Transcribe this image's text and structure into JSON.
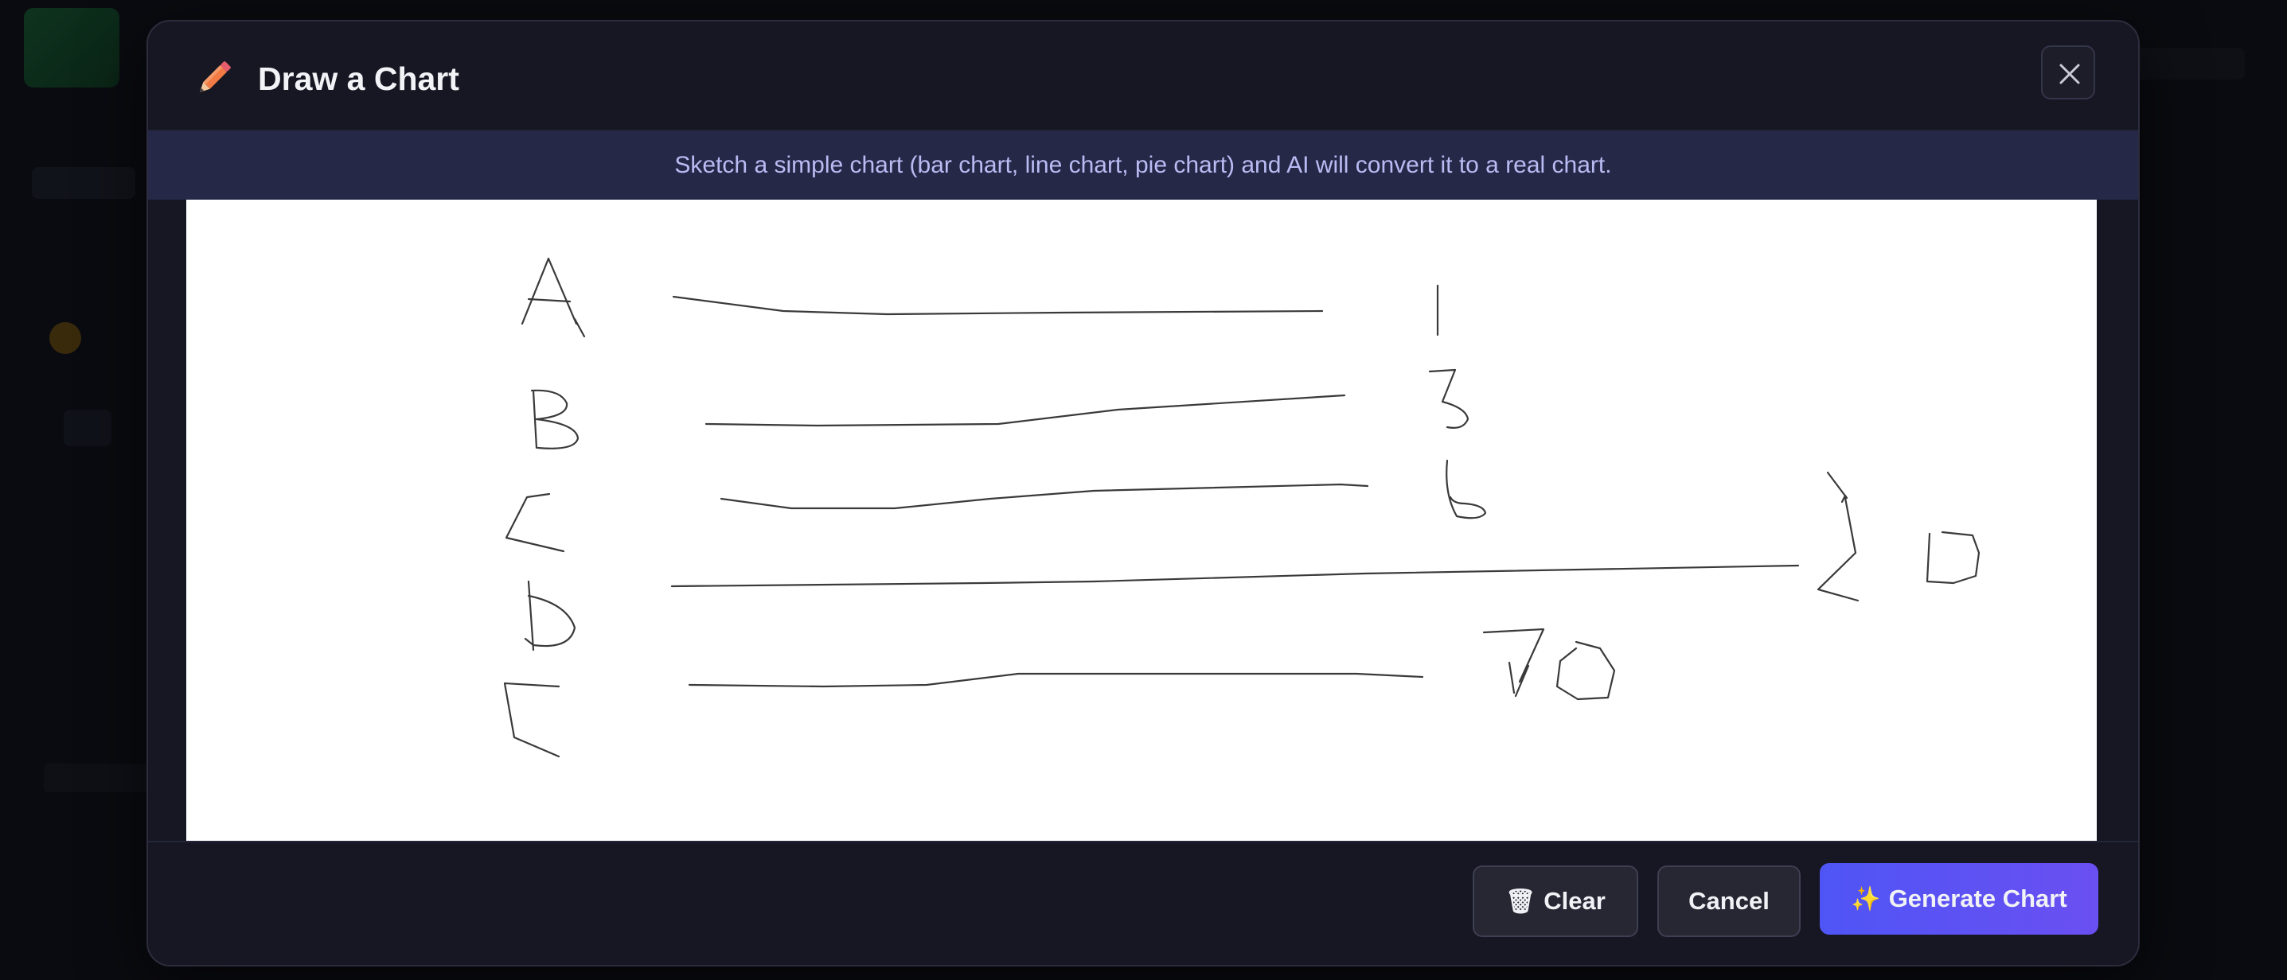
{
  "dialog": {
    "title": "Draw a Chart",
    "instructions": "Sketch a simple chart (bar chart, line chart, pie chart) and AI will convert it to a real chart.",
    "close_icon": "close-icon",
    "title_icon": "pencil-icon"
  },
  "canvas": {
    "sketch_labels": [
      "A",
      "B",
      "C",
      "D",
      "E"
    ],
    "sketch_values": [
      "1",
      "3",
      "6",
      "20",
      "70"
    ]
  },
  "footer": {
    "clear_icon": "🗑",
    "clear_label": "Clear",
    "cancel_label": "Cancel",
    "generate_icon": "✨",
    "generate_label": "Generate Chart"
  },
  "colors": {
    "accent": "#5b52f4",
    "pencil": "#f0734e",
    "banner": "#262848"
  }
}
